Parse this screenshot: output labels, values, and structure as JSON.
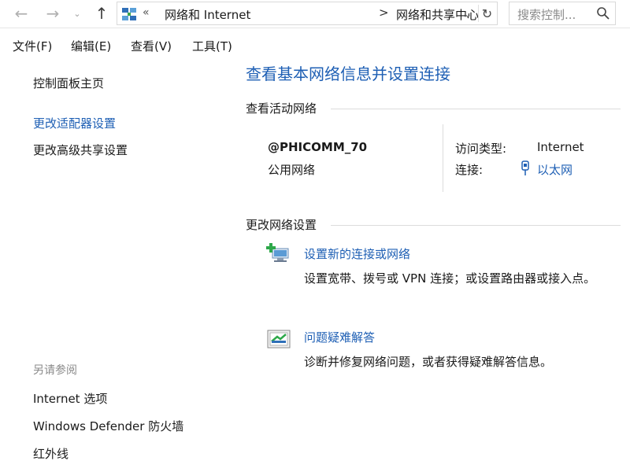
{
  "address_bar": {
    "chevron": "«",
    "segment1": "网络和 Internet",
    "separator": ">",
    "segment2": "网络和共享中心"
  },
  "search": {
    "placeholder": "搜索控制..."
  },
  "menu": [
    {
      "label": "文件(F)"
    },
    {
      "label": "编辑(E)"
    },
    {
      "label": "查看(V)"
    },
    {
      "label": "工具(T)"
    }
  ],
  "sidebar": {
    "items": [
      {
        "label": "控制面板主页"
      },
      {
        "label": "更改适配器设置"
      },
      {
        "label": "更改高级共享设置"
      }
    ],
    "see_also_title": "另请参阅",
    "see_also": [
      {
        "label": "Internet 选项"
      },
      {
        "label": "Windows Defender 防火墙"
      },
      {
        "label": "红外线"
      }
    ]
  },
  "main": {
    "title": "查看基本网络信息并设置连接",
    "active_networks_header": "查看活动网络",
    "network": {
      "name": "@PHICOMM_70",
      "category": "公用网络",
      "access_type_label": "访问类型:",
      "access_type_value": "Internet",
      "connection_label": "连接:",
      "connection_value": "以太网"
    },
    "change_settings_header": "更改网络设置",
    "tasks": [
      {
        "title": "设置新的连接或网络",
        "desc": "设置宽带、拨号或 VPN 连接；或设置路由器或接入点。"
      },
      {
        "title": "问题疑难解答",
        "desc": "诊断并修复网络问题，或者获得疑难解答信息。"
      }
    ]
  },
  "colors": {
    "link": "#1e5fb4",
    "divider": "#dcdcdc"
  }
}
